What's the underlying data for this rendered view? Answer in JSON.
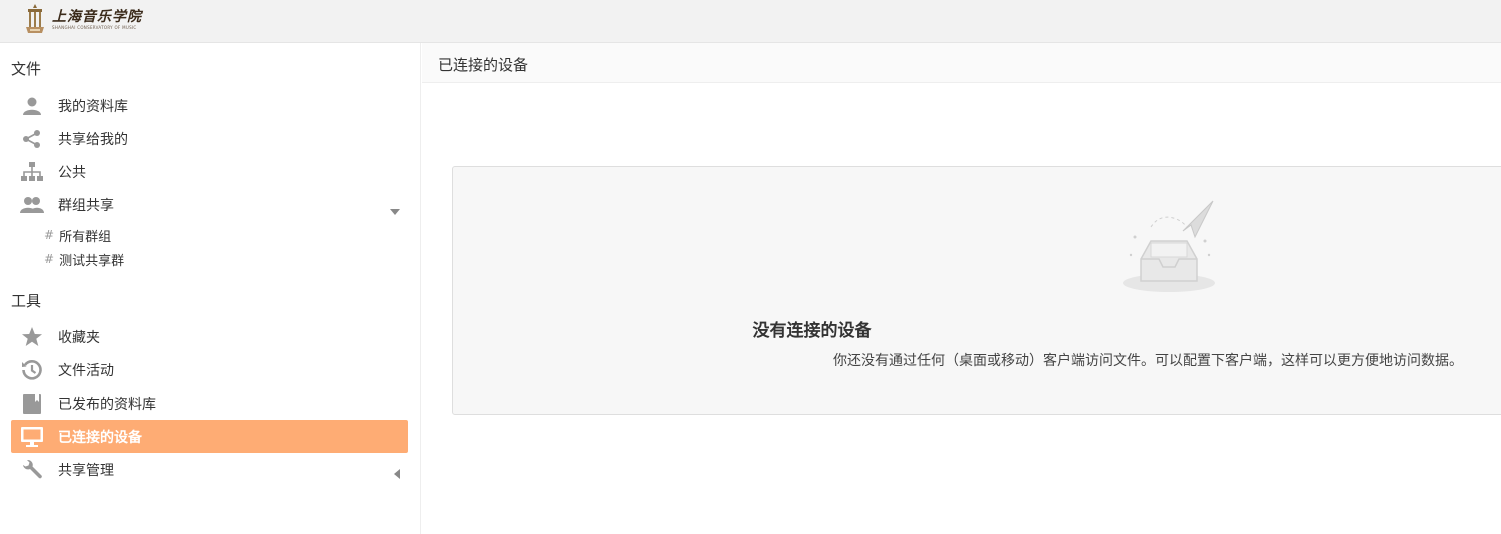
{
  "header": {
    "logo_title": "上海音乐学院",
    "logo_subtitle": "SHANGHAI CONSERVATORY OF MUSIC"
  },
  "sidebar": {
    "files_section": "文件",
    "tools_section": "工具",
    "file_items": [
      {
        "label": "我的资料库",
        "icon": "user-icon"
      },
      {
        "label": "共享给我的",
        "icon": "share-icon"
      },
      {
        "label": "公共",
        "icon": "org-tree-icon"
      },
      {
        "label": "群组共享",
        "icon": "group-icon"
      }
    ],
    "group_subitems": [
      {
        "hash": "#",
        "label": "所有群组"
      },
      {
        "hash": "#",
        "label": "测试共享群"
      }
    ],
    "tool_items": [
      {
        "label": "收藏夹",
        "icon": "star-icon"
      },
      {
        "label": "文件活动",
        "icon": "history-icon"
      },
      {
        "label": "已发布的资料库",
        "icon": "book-icon"
      },
      {
        "label": "已连接的设备",
        "icon": "monitor-icon",
        "active": true
      },
      {
        "label": "共享管理",
        "icon": "wrench-icon"
      }
    ]
  },
  "main": {
    "title": "已连接的设备",
    "empty_title": "没有连接的设备",
    "empty_desc": "你还没有通过任何（桌面或移动）客户端访问文件。可以配置下客户端，这样可以更方便地访问数据。"
  },
  "colors": {
    "active_bg": "#feac74",
    "icon_gray": "#999999"
  }
}
